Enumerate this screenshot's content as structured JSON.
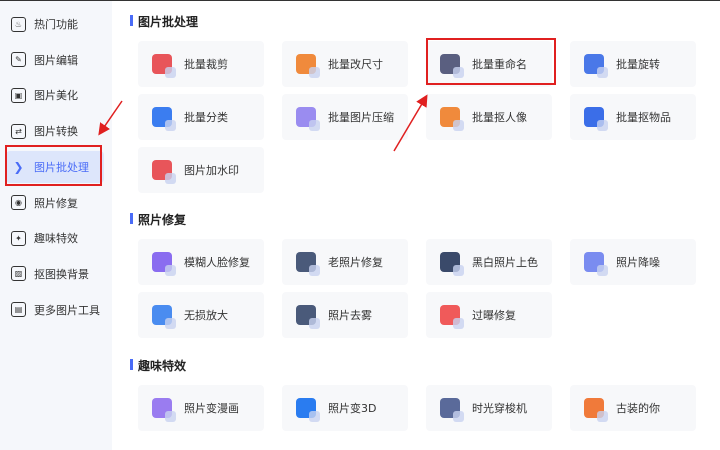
{
  "sidebar": {
    "items": [
      {
        "label": "热门功能",
        "icon": "flame-icon"
      },
      {
        "label": "图片编辑",
        "icon": "image-edit-icon"
      },
      {
        "label": "图片美化",
        "icon": "image-beautify-icon"
      },
      {
        "label": "图片转换",
        "icon": "convert-icon"
      },
      {
        "label": "图片批处理",
        "icon": "batch-icon",
        "active": true
      },
      {
        "label": "照片修复",
        "icon": "photo-repair-icon"
      },
      {
        "label": "趣味特效",
        "icon": "magic-wand-icon"
      },
      {
        "label": "抠图换背景",
        "icon": "cutout-icon"
      },
      {
        "label": "更多图片工具",
        "icon": "toolbox-icon"
      }
    ]
  },
  "sections": [
    {
      "title": "图片批处理",
      "items": [
        {
          "label": "批量裁剪",
          "color": "#e8555a"
        },
        {
          "label": "批量改尺寸",
          "color": "#f08a3c"
        },
        {
          "label": "批量重命名",
          "color": "#5a5f80"
        },
        {
          "label": "批量旋转",
          "color": "#4a78e8"
        },
        {
          "label": "批量分类",
          "color": "#3b7df0"
        },
        {
          "label": "批量图片压缩",
          "color": "#9a8cf0"
        },
        {
          "label": "批量抠人像",
          "color": "#f08a3c"
        },
        {
          "label": "批量抠物品",
          "color": "#3b6ee8"
        },
        {
          "label": "图片加水印",
          "color": "#e8555a"
        }
      ]
    },
    {
      "title": "照片修复",
      "items": [
        {
          "label": "模糊人脸修复",
          "color": "#8a6cf0"
        },
        {
          "label": "老照片修复",
          "color": "#4a5a7a"
        },
        {
          "label": "黑白照片上色",
          "color": "#3a4a6a"
        },
        {
          "label": "照片降噪",
          "color": "#7a8cf0"
        },
        {
          "label": "无损放大",
          "color": "#4a8cf0"
        },
        {
          "label": "照片去雾",
          "color": "#4a5a7a"
        },
        {
          "label": "过曝修复",
          "color": "#f05a5a"
        }
      ]
    },
    {
      "title": "趣味特效",
      "items": [
        {
          "label": "照片变漫画",
          "color": "#9a7cf0"
        },
        {
          "label": "照片变3D",
          "color": "#2a7cf0"
        },
        {
          "label": "时光穿梭机",
          "color": "#5a6a9a"
        },
        {
          "label": "古装的你",
          "color": "#f07a3a"
        }
      ]
    }
  ]
}
